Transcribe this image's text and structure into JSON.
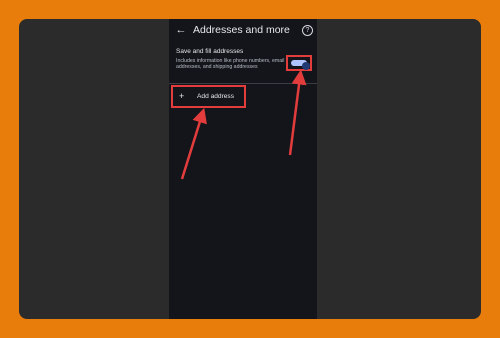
{
  "screen": {
    "title": "Addresses and more",
    "back_icon": "arrow-back-icon",
    "help_icon": "help-icon"
  },
  "setting": {
    "title": "Save and fill addresses",
    "description": "Includes information like phone numbers, email addresses, and shipping addresses",
    "toggle_on": true
  },
  "add_address": {
    "label": "Add address",
    "icon": "plus-icon"
  },
  "colors": {
    "frame_background": "#e97d0b",
    "screen_background": "#13151b",
    "highlight": "#e33c3c",
    "toggle_on_track": "#aec5ff"
  }
}
